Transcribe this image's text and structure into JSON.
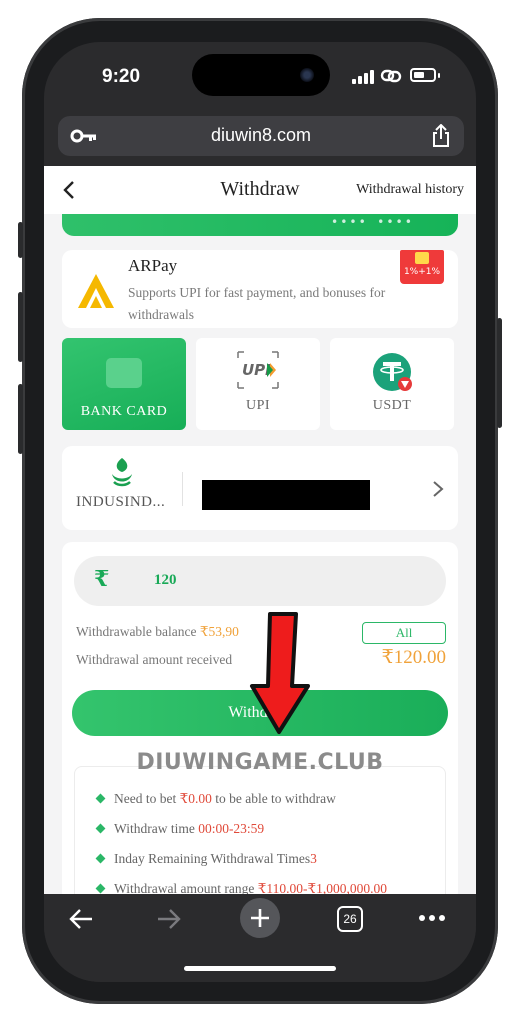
{
  "status_bar": {
    "time": "9:20"
  },
  "browser": {
    "url": "diuwin8.com",
    "open_tabs": "26"
  },
  "header": {
    "title": "Withdraw",
    "history_link": "Withdrawal history"
  },
  "promo_strip": {
    "dots": "•••• ••••"
  },
  "arpay": {
    "name": "ARPay",
    "description": "Supports UPI for fast payment, and bonuses for withdrawals",
    "badge": "1%+1%"
  },
  "payment_methods": [
    {
      "label": "BANK CARD",
      "selected": true
    },
    {
      "label": "UPI",
      "selected": false
    },
    {
      "label": "USDT",
      "selected": false
    }
  ],
  "bank": {
    "name": "INDUSIND..."
  },
  "amount": {
    "currency_symbol": "₹",
    "value": "120"
  },
  "balance": {
    "label": "Withdrawable balance",
    "value": "₹53,90",
    "all_button": "All",
    "received_label": "Withdrawal amount received",
    "received_value": "₹120.00"
  },
  "withdraw_button": "Withdraw",
  "watermark": "DIUWINGAME.CLUB",
  "rules": [
    {
      "prefix": "Need to bet ",
      "highlight": "₹0.00",
      "suffix": " to be able to withdraw"
    },
    {
      "prefix": "Withdraw time ",
      "highlight": "00:00-23:59",
      "suffix": ""
    },
    {
      "prefix": "Inday Remaining Withdrawal Times",
      "highlight": "3",
      "suffix": ""
    },
    {
      "prefix": "Withdrawal amount range ",
      "highlight": "₹110.00-₹1,000,000.00",
      "suffix": ""
    }
  ],
  "colors": {
    "brand_green": "#1aae59",
    "accent_orange": "#f0a23a",
    "highlight_red": "#e04a3a",
    "arrow_red": "#ee1c1c"
  }
}
